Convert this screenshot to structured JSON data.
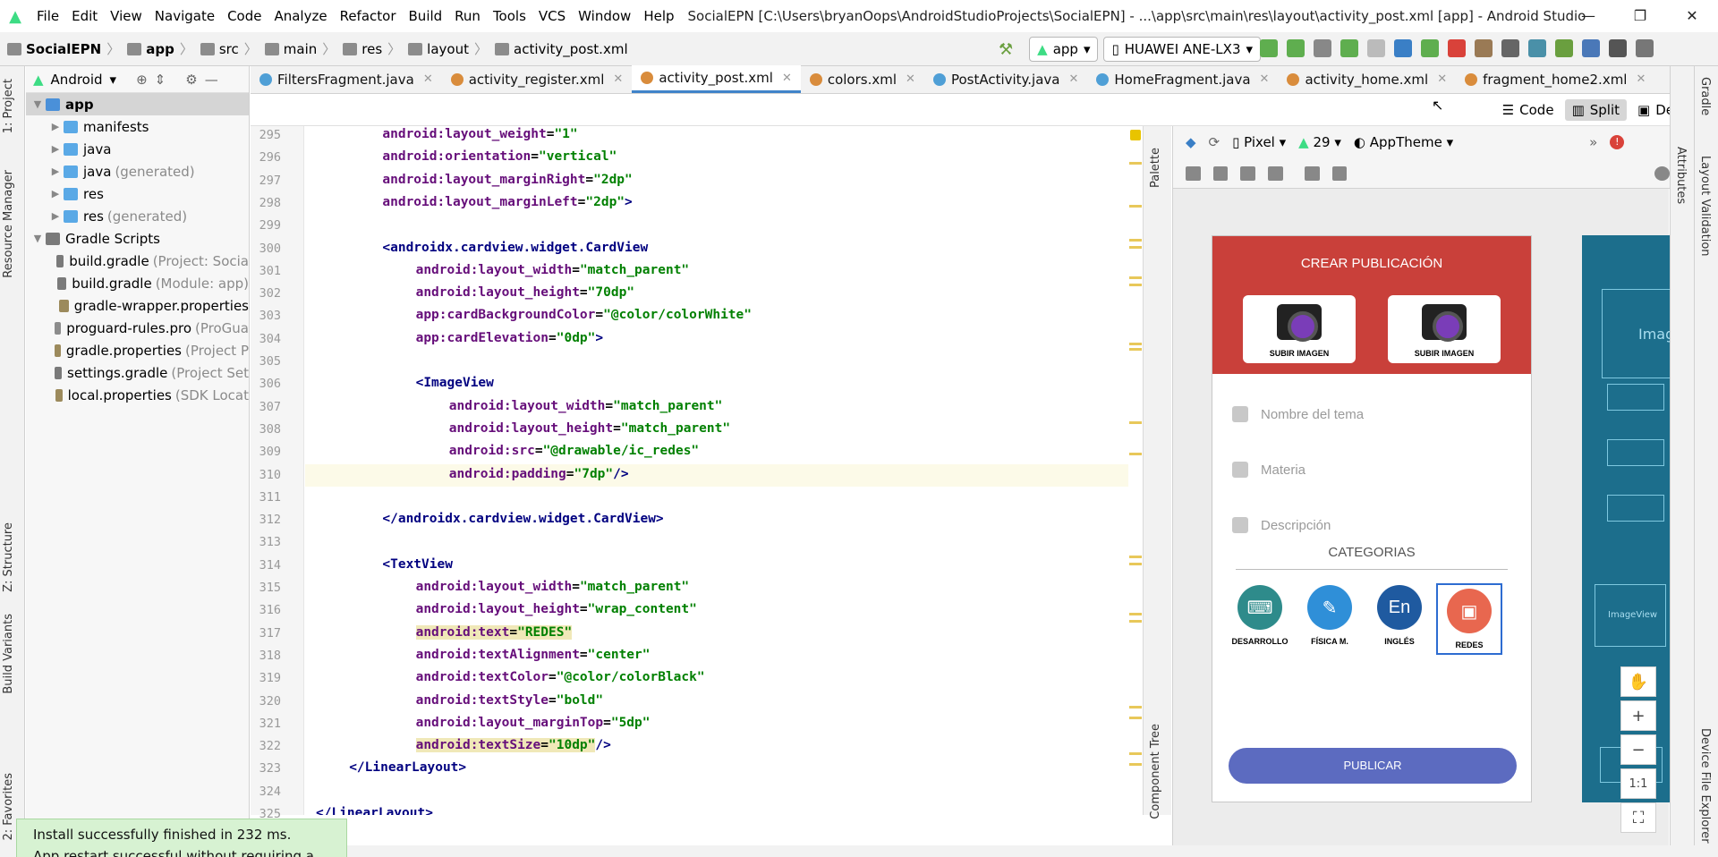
{
  "app": {
    "menus": [
      "File",
      "Edit",
      "View",
      "Navigate",
      "Code",
      "Analyze",
      "Refactor",
      "Build",
      "Run",
      "Tools",
      "VCS",
      "Window",
      "Help"
    ],
    "title": "SocialEPN [C:\\Users\\bryanOops\\AndroidStudioProjects\\SocialEPN] - ...\\app\\src\\main\\res\\layout\\activity_post.xml [app] - Android Studio",
    "window_buttons": [
      "—",
      "❐",
      "✕"
    ]
  },
  "breadcrumb": [
    "SocialEPN",
    "app",
    "src",
    "main",
    "res",
    "layout",
    "activity_post.xml"
  ],
  "run": {
    "config": "app",
    "device": "HUAWEI ANE-LX3"
  },
  "left_stripe": [
    "1: Project",
    "Resource Manager",
    "Z: Structure",
    "Build Variants",
    "2: Favorites"
  ],
  "project": {
    "view": "Android",
    "tree": [
      {
        "label": "app",
        "sub": "",
        "level": 0,
        "arrow": "▼",
        "color": "#4a90d9",
        "selected": true,
        "bold": true
      },
      {
        "label": "manifests",
        "sub": "",
        "level": 1,
        "arrow": "▶",
        "color": "#5aa9e6"
      },
      {
        "label": "java",
        "sub": "",
        "level": 1,
        "arrow": "▶",
        "color": "#5aa9e6"
      },
      {
        "label": "java",
        "sub": "(generated)",
        "level": 1,
        "arrow": "▶",
        "color": "#5aa9e6"
      },
      {
        "label": "res",
        "sub": "",
        "level": 1,
        "arrow": "▶",
        "color": "#5aa9e6"
      },
      {
        "label": "res",
        "sub": "(generated)",
        "level": 1,
        "arrow": "▶",
        "color": "#5aa9e6"
      },
      {
        "label": "Gradle Scripts",
        "sub": "",
        "level": 0,
        "arrow": "▼",
        "color": "#7a7a7a"
      },
      {
        "label": "build.gradle",
        "sub": "(Project: Socia",
        "level": 1,
        "arrow": "",
        "color": "#7a7a7a"
      },
      {
        "label": "build.gradle",
        "sub": "(Module: app)",
        "level": 1,
        "arrow": "",
        "color": "#7a7a7a"
      },
      {
        "label": "gradle-wrapper.properties",
        "sub": "",
        "level": 1,
        "arrow": "",
        "color": "#9c8a5c"
      },
      {
        "label": "proguard-rules.pro",
        "sub": "(ProGua",
        "level": 1,
        "arrow": "",
        "color": "#8c8c8c"
      },
      {
        "label": "gradle.properties",
        "sub": "(Project P",
        "level": 1,
        "arrow": "",
        "color": "#9c8a5c"
      },
      {
        "label": "settings.gradle",
        "sub": "(Project Set",
        "level": 1,
        "arrow": "",
        "color": "#7a7a7a"
      },
      {
        "label": "local.properties",
        "sub": "(SDK Locat",
        "level": 1,
        "arrow": "",
        "color": "#9c8a5c"
      }
    ]
  },
  "tabs": [
    {
      "label": "FiltersFragment.java",
      "color": "#4f9fd6",
      "active": false
    },
    {
      "label": "activity_register.xml",
      "color": "#d98c3c",
      "active": false
    },
    {
      "label": "activity_post.xml",
      "color": "#d98c3c",
      "active": true
    },
    {
      "label": "colors.xml",
      "color": "#d98c3c",
      "active": false
    },
    {
      "label": "PostActivity.java",
      "color": "#4f9fd6",
      "active": false
    },
    {
      "label": "HomeFragment.java",
      "color": "#4f9fd6",
      "active": false
    },
    {
      "label": "activity_home.xml",
      "color": "#d98c3c",
      "active": false
    },
    {
      "label": "fragment_home2.xml",
      "color": "#d98c3c",
      "active": false
    }
  ],
  "modes": [
    "Code",
    "Split",
    "Design"
  ],
  "code_lines": [
    {
      "n": "295",
      "indent": 8,
      "parts": [
        [
          "attr",
          "android:layout_weight"
        ],
        [
          "plain",
          "="
        ],
        [
          "val",
          "\"1\""
        ]
      ]
    },
    {
      "n": "296",
      "indent": 8,
      "parts": [
        [
          "attr",
          "android:orientation"
        ],
        [
          "plain",
          "="
        ],
        [
          "val",
          "\"vertical\""
        ]
      ]
    },
    {
      "n": "297",
      "indent": 8,
      "parts": [
        [
          "attr",
          "android:layout_marginRight"
        ],
        [
          "plain",
          "="
        ],
        [
          "val",
          "\"2dp\""
        ]
      ]
    },
    {
      "n": "298",
      "indent": 8,
      "parts": [
        [
          "attr",
          "android:layout_marginLeft"
        ],
        [
          "plain",
          "="
        ],
        [
          "val",
          "\"2dp\""
        ],
        [
          "tag",
          ">"
        ]
      ]
    },
    {
      "n": "299",
      "indent": 0,
      "parts": []
    },
    {
      "n": "300",
      "indent": 8,
      "parts": [
        [
          "tag",
          "<androidx.cardview.widget.CardView"
        ]
      ]
    },
    {
      "n": "301",
      "indent": 12,
      "parts": [
        [
          "attr",
          "android:layout_width"
        ],
        [
          "plain",
          "="
        ],
        [
          "val",
          "\"match_parent\""
        ]
      ]
    },
    {
      "n": "302",
      "indent": 12,
      "parts": [
        [
          "attr",
          "android:layout_height"
        ],
        [
          "plain",
          "="
        ],
        [
          "val",
          "\"70dp\""
        ]
      ]
    },
    {
      "n": "303",
      "indent": 12,
      "parts": [
        [
          "attr",
          "app:cardBackgroundColor"
        ],
        [
          "plain",
          "="
        ],
        [
          "val",
          "\"@color/colorWhite\""
        ]
      ]
    },
    {
      "n": "304",
      "indent": 12,
      "parts": [
        [
          "attr",
          "app:cardElevation"
        ],
        [
          "plain",
          "="
        ],
        [
          "val",
          "\"0dp\""
        ],
        [
          "tag",
          ">"
        ]
      ]
    },
    {
      "n": "305",
      "indent": 0,
      "parts": []
    },
    {
      "n": "306",
      "indent": 12,
      "parts": [
        [
          "tag",
          "<ImageView"
        ]
      ]
    },
    {
      "n": "307",
      "indent": 16,
      "parts": [
        [
          "attr",
          "android:layout_width"
        ],
        [
          "plain",
          "="
        ],
        [
          "val",
          "\"match_parent\""
        ]
      ]
    },
    {
      "n": "308",
      "indent": 16,
      "parts": [
        [
          "attr",
          "android:layout_height"
        ],
        [
          "plain",
          "="
        ],
        [
          "val",
          "\"match_parent\""
        ]
      ]
    },
    {
      "n": "309",
      "indent": 16,
      "parts": [
        [
          "attr",
          "android:src"
        ],
        [
          "plain",
          "="
        ],
        [
          "val",
          "\"@drawable/ic_redes\""
        ]
      ]
    },
    {
      "n": "310",
      "indent": 16,
      "parts": [
        [
          "attr",
          "android:padding"
        ],
        [
          "plain",
          "="
        ],
        [
          "val",
          "\"7dp\""
        ],
        [
          "tag",
          "/>"
        ]
      ]
    },
    {
      "n": "311",
      "indent": 0,
      "parts": []
    },
    {
      "n": "312",
      "indent": 8,
      "parts": [
        [
          "tag",
          "</androidx.cardview.widget.CardView>"
        ]
      ]
    },
    {
      "n": "313",
      "indent": 0,
      "parts": []
    },
    {
      "n": "314",
      "indent": 8,
      "parts": [
        [
          "tag",
          "<TextView"
        ]
      ]
    },
    {
      "n": "315",
      "indent": 12,
      "parts": [
        [
          "attr",
          "android:layout_width"
        ],
        [
          "plain",
          "="
        ],
        [
          "val",
          "\"match_parent\""
        ]
      ]
    },
    {
      "n": "316",
      "indent": 12,
      "parts": [
        [
          "attr",
          "android:layout_height"
        ],
        [
          "plain",
          "="
        ],
        [
          "val",
          "\"wrap_content\""
        ]
      ]
    },
    {
      "n": "317",
      "indent": 12,
      "parts": [
        [
          "attr",
          "android:text"
        ],
        [
          "plain",
          "="
        ],
        [
          "val",
          "\"REDES\""
        ]
      ]
    },
    {
      "n": "318",
      "indent": 12,
      "parts": [
        [
          "attr",
          "android:textAlignment"
        ],
        [
          "plain",
          "="
        ],
        [
          "val",
          "\"center\""
        ]
      ]
    },
    {
      "n": "319",
      "indent": 12,
      "parts": [
        [
          "attr",
          "android:textColor"
        ],
        [
          "plain",
          "="
        ],
        [
          "val",
          "\"@color/colorBlack\""
        ]
      ]
    },
    {
      "n": "320",
      "indent": 12,
      "parts": [
        [
          "attr",
          "android:textStyle"
        ],
        [
          "plain",
          "="
        ],
        [
          "val",
          "\"bold\""
        ]
      ]
    },
    {
      "n": "321",
      "indent": 12,
      "parts": [
        [
          "attr",
          "android:layout_marginTop"
        ],
        [
          "plain",
          "="
        ],
        [
          "val",
          "\"5dp\""
        ]
      ]
    },
    {
      "n": "322",
      "indent": 12,
      "parts": [
        [
          "attr",
          "android:textSize"
        ],
        [
          "plain",
          "="
        ],
        [
          "val",
          "\"10dp\""
        ],
        [
          "tag",
          "/>"
        ]
      ]
    },
    {
      "n": "323",
      "indent": 4,
      "parts": [
        [
          "tag",
          "</LinearLayout>"
        ]
      ]
    },
    {
      "n": "324",
      "indent": 0,
      "parts": []
    },
    {
      "n": "325",
      "indent": 0,
      "parts": [
        [
          "tag",
          "</LinearLayout>"
        ]
      ]
    }
  ],
  "design": {
    "device": "Pixel",
    "api": "29",
    "theme": "AppTheme",
    "palette_label": "Palette",
    "component_tree_label": "Component Tree",
    "header_title": "CREAR PUBLICACIÓN",
    "upload_label": "SUBIR IMAGEN",
    "fields": [
      "Nombre del tema",
      "Materia",
      "Descripción"
    ],
    "categories_title": "CATEGORIAS",
    "categories": [
      {
        "label": "DESARROLLO",
        "color": "#2e8b8b",
        "glyph": "⌨"
      },
      {
        "label": "FÍSICA M.",
        "color": "#2f8fd8",
        "glyph": "✎"
      },
      {
        "label": "INGLÉS",
        "color": "#1f5aa0",
        "glyph": "En"
      },
      {
        "label": "REDES",
        "color": "#e8674f",
        "glyph": "▣"
      }
    ],
    "publish": "PUBLICAR",
    "blueprint_labels": [
      "Imag",
      "ImageView"
    ],
    "zoom": [
      "✋",
      "+",
      "−",
      "1:1",
      "⛶"
    ]
  },
  "right_stripe": [
    "Gradle",
    "Attributes",
    "Layout Validation",
    "Device File Explorer"
  ],
  "toast": {
    "line1": "Install successfully finished in 232 ms.",
    "line2": "App restart successful without requiring a re-install."
  }
}
